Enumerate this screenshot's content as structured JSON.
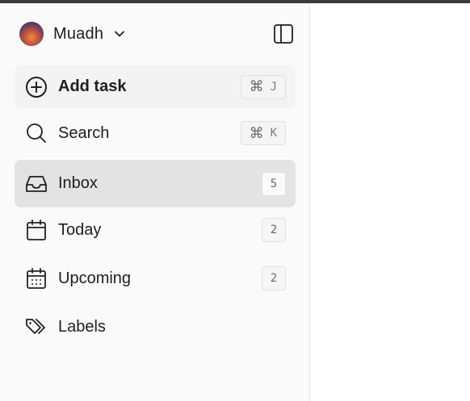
{
  "user": {
    "name": "Muadh"
  },
  "nav": {
    "add_task": {
      "label": "Add task",
      "shortcut_symbol": "⌘",
      "shortcut_key": "J"
    },
    "search": {
      "label": "Search",
      "shortcut_symbol": "⌘",
      "shortcut_key": "K"
    },
    "inbox": {
      "label": "Inbox",
      "count": "5"
    },
    "today": {
      "label": "Today",
      "count": "2"
    },
    "upcoming": {
      "label": "Upcoming",
      "count": "2"
    },
    "labels": {
      "label": "Labels"
    }
  },
  "colors": {
    "sidebar_bg": "#fafafa",
    "active_bg": "#e3e3e3",
    "add_bg": "#f3f3f3"
  }
}
